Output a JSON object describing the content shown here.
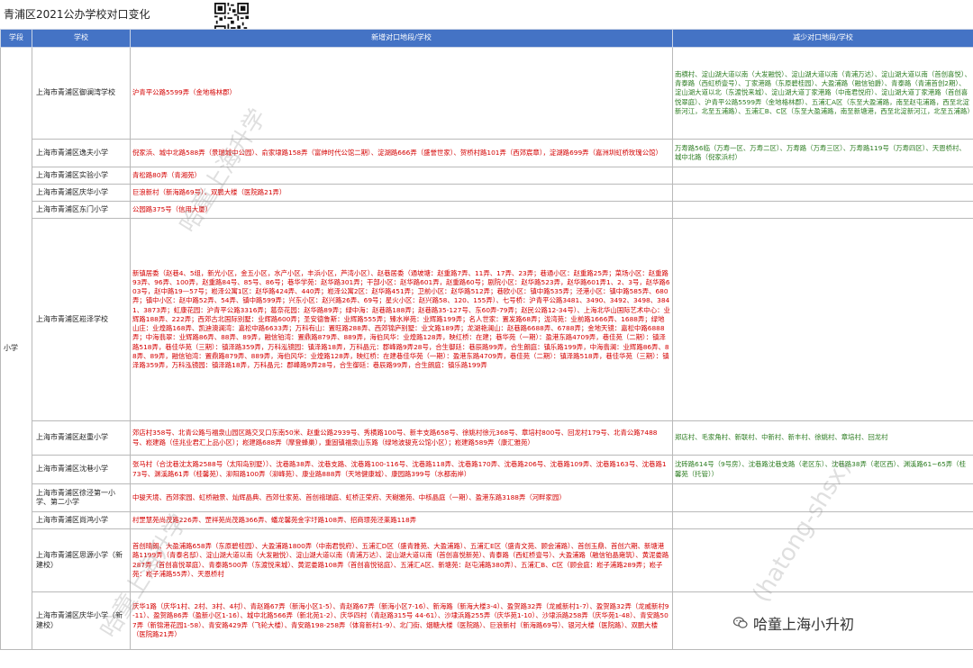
{
  "title": "青浦区2021公办学校对口变化",
  "headers": {
    "level": "学段",
    "school": "学校",
    "added": "新增对口地段/学校",
    "removed": "减少对口地段/学校"
  },
  "level_label": "小学",
  "rows": [
    {
      "school": "上海市青浦区御澜湾学校",
      "added": "沪青平公路5599弄（金地格林郡）",
      "removed": "南横村、淀山湖大道以南（大发融悦）、淀山湖大道以南（青浦万达）、淀山湖大道以南（首创喜悦）、青泰路（西虹桥壹号）、丁家港路（东原碧桂园）、大盈浦路（融信铂爵）、青泰路（青浦首创2期）、淀山湖大道以北（东渡悦来城）、淀山湖大道丁家港路（中南君悦府）、淀山湖大道丁家港路（首创喜悦翠庭）、沪青平公路5599弄（金地格林郡）、五浦汇A区（东至大盈浦路，南至赵屯浦路，西至北淀新河江，北至五浦路）、五浦汇B、C区（东至大盈浦路，南至新塘港，西至北淀新河江，北至五浦路）"
    },
    {
      "school": "上海市青浦区逸夫小学",
      "added": "倪家浜、城中北路588弄（景瑞城中公园）、俞家埭路158弄（富绅时代公馆二期）、淀湖路666弄（盛誉世家）、贺桥村路101弄（西郊宸章），淀湖路699弄（嘉洲圳虹桥玫瑰公馆）",
      "removed": "万寿路56临（万寿一区、万寿二区）、万寿路（万寿三区）、万寿路119号（万寿四区）、天恩桥村、城中北路（倪家浜村）"
    },
    {
      "school": "上海市青浦区实验小学",
      "added": "青松路80弄（青湘苑）",
      "removed": ""
    },
    {
      "school": "上海市青浦区庆华小学",
      "added": "巨浪新村（新海路69号）、双鹏大楼（医院路21弄）",
      "removed": ""
    },
    {
      "school": "上海市青浦区东门小学",
      "added": "公园路375号（信用大厦）",
      "removed": ""
    },
    {
      "school": "上海市青浦区崧泽学校",
      "added": "新镇居委（赵巷4、5组，新光小区，金五小区，水产小区，丰浜小区，芦湾小区）、赵巷居委（通坡塘：赵重路7弄、11弄、17弄、23弄；巷通小区：赵重路25弄；菜场小区：赵重路93弄、96弄、100弄，赵重路84号、85号、86号；巷华学苑：赵华路301弄；干部小区：赵华路601弄，赵重路60号；剧院小区：赵华路523弄，赵华路601弄1、2、3号，赵华路603号，赵中路19—57号；崧泽公寓1区：赵华路424弄、440弄；崧泽公寓2区：赵华路451弄；卫前小区：赵华路512弄；巷欧小区：镇中路535弄；泾港小区：镇中路585弄、680弄；镇中小区：赵中路52弄、54弄、镇中路599弄；兴东小区：赵兴路26弄、69号；星火小区：赵兴路58、120、155弄）、七号桥：沪青平公路3481、3490、3492、3498、3841、3873弄；虹康花园：沪青平公路3316弄；葛奈花园：赵华路89弄；绿中海：赵巷路188弄；赵巷路35-127号、东60弄-79弄；赵民公路12-34号）、上海北华山国际艺术中心：业辉路188弄、222弄；西郊古北国际别墅：业辉路600弄；圣安德鲁斯：业辉路555弄；臻水岸苑：业辉路199弄；名人世家：置发路68弄；泷湾苑：业前路1666弄、1688弄；绿地山庄：业煌路168弄、凯迪澳澜湾：嘉松中路6633弄；万科有山：置旺路288弄、西郊锦庐别墅：业文路189弄；龙湖艳澜山：赵巷路6688弄、6788弄；金地天镜：嘉松中路6888弄；中海翡翠：业辉路86弄、88弄、89弄，融信铂湾：置鼎路879弄、889弄，海伯风华：业煌路128弄，映红桥：在建；巷华苑（一期）：盈港东路4709弄，巷佳苑（二期）：镇泽路518弄，巷佳华苑（三期）：镇泽路359弄，万科泓镜园：镇泽路18弄，万科晶元：郡峰路9弄28号，合生御廷：巷辰路99弄，合生朗庭：镇乐路199弄，中海翡澜：业辉路86弄、88弄、89弄，融信铂湾：置鼎路879弄、889弄，海伯风华：业煌路128弄，映红桥：在建巷佳华苑（一期）：盈港东路4709弄，巷佳苑（二期）：镇泽路518弄，巷佳华苑（三期）：镇泽路359弄，万科泓镜园：镇泽路18弄，万科晶元：郡峰路9弄28号，合生御廷：巷辰路99弄，合生朗庭：镇乐路199弄",
      "removed": ""
    },
    {
      "school": "上海市青浦区赵重小学",
      "added": "郊店村358号、北青公路与福泉山园区路交叉口东南50米、赵重公路2939号、秀横路100号、新丰支路658号、徐姚村徐元368号、章培村800号、回龙村179号、北青公路7488号、崧建路（佳兆业君汇上品小区）；崧建路688弄（摩登蜂巢），重固镇福泉山东路（绿地波骏克公馆小区）；崧建路589弄（康汇雅苑）",
      "removed": "郑店村、毛家角村、新联村、中新村、新丰村、徐姚村、章培村、回龙村"
    },
    {
      "school": "上海市青浦区沈巷小学",
      "added": "张马村（合沈巷沈太路2588号（太阳岛别墅））、沈巷路38弄、沈巷支路、沈巷路100-116号、沈巷路118弄、沈巷路170弄、沈巷路206号、沈巷路109弄、沈巷路163号、沈巷路173号、渊溪路61弄（桂馨苑）、泖阳路100弄（泖峰苑）、康业路888弄（天地健康城）、康园路399号（水都南岸）",
      "removed": "沈砖路614号（9号房）、沈巷路沈巷支路（老区东）、沈巷路38弄（老区西）、渊溪路61~65弄（桂馨苑（托管））"
    },
    {
      "school": "上海市青浦区徐泾第一小学、第二小学",
      "added": "中骏天境、西郊家园、虹桥融景、灿辉晶典、西郊仕家苑、首创禧瑞庭、虹桥正荣府、天樾雅苑、中核晶庭（一期）、盈港东路3188弄（河畔家园）",
      "removed": ""
    },
    {
      "school": "上海市青浦区尚鸿小学",
      "added": "村罡慧苑尚茂路226弄、罡祥苑尚茂路366弄、蟠龙馨苑金字圩路108弄、招商璟苑泾莱路118弄",
      "removed": ""
    },
    {
      "school": "上海市青浦区思源小学（新建校）",
      "added": "首创晴朗、大盈浦路658弄（东原碧桂园）、大盈浦路1800弄（中南君悦府）、五浦汇D区（盛青雅苑、大盈浦路）、五浦汇E区（盛青文苑、顾会浦路）、首创玉鼎、首创六期、新塘港路1199弄（青泰名邸）、淀山湖大道以南（大发融悦）、淀山湖大道以南（青浦万达）、淀山湖大道以南（首创喜悦新苑）、青泰路（西虹桥壹号）、大盈浦路（融信铂晶雍筑）、黄泥娄路287弄（首创喜悦翠庭）、青泰路500弄（东渡悦来城）、黄泥娄路108弄（首创喜悦铭庭）、五浦汇A区、新塘苑：赵屯浦路380弄）、五浦汇B、C区（顾会庭：崧子浦路289弄；崧子苑：崧子浦路55弄）、天恩桥村",
      "removed": ""
    },
    {
      "school": "上海市青浦区庆华小学（新建校）",
      "added": "庆华1路（庆华1村、2村、3村、4村）、青赵路67弄（新海小区1-5）、青赵路67弄（新海小区7-16）、新海路（新海大楼3-4）、盈贺路32弄（龙威新村1-7）、盈贺路32弄（龙威新村9-11）、盈贺路86弄（盈新小区1-16）、城中北路566弄（新北苑1-2）、庆华四村（青赵路315号 44-61）、沙埭浜路255弄（庆华苑1-10）、沙埭浜路258弄（庆华苑1-48）、青安路507弄（新锦港花园1-58）、青安路429弄（飞轮大楼）、青安路198-258弄（体育新村1-9）、北门街、烟糖大楼（医院路）、巨浪新村（新海路69号）、银河大楼（医院路）、双鹏大楼（医院路21弄）",
      "removed": ""
    }
  ],
  "watermarks": [
    "哈童上海升学",
    "(hatong-shsx)"
  ],
  "brand": {
    "icon": "wechat-icon",
    "text": "哈童上海小升初"
  }
}
